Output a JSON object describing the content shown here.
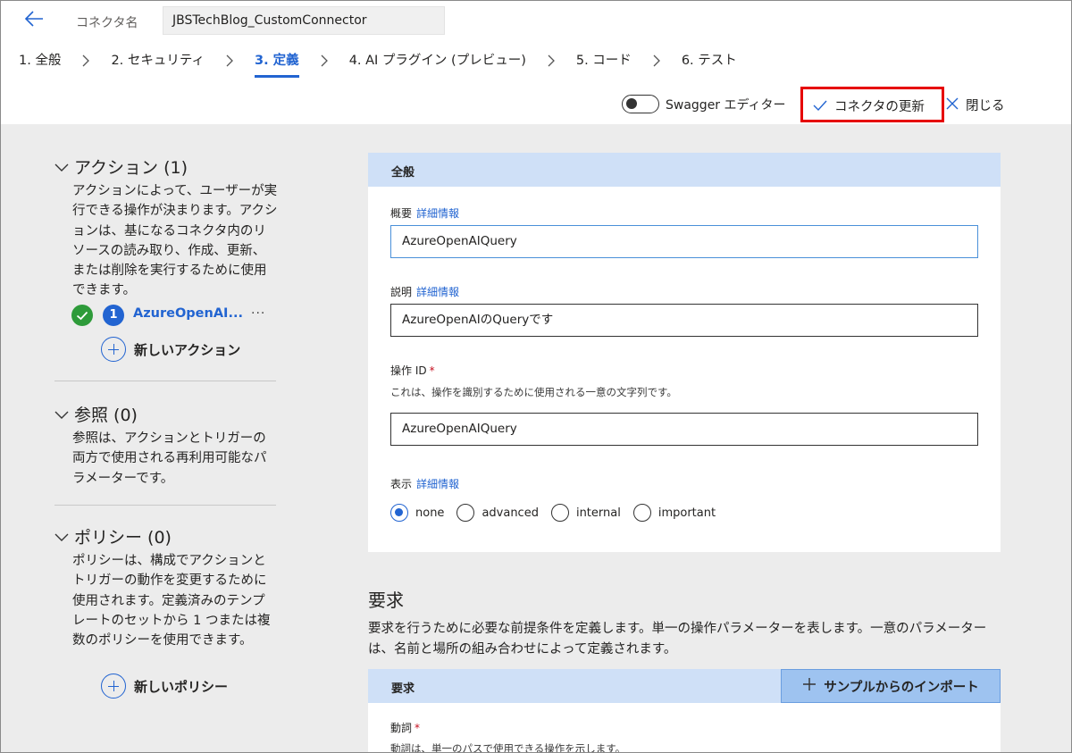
{
  "header": {
    "connector_label": "コネクタ名",
    "connector_name": "JBSTechBlog_CustomConnector"
  },
  "steps": [
    {
      "label": "1. 全般",
      "active": false
    },
    {
      "label": "2. セキュリティ",
      "active": false
    },
    {
      "label": "3. 定義",
      "active": true
    },
    {
      "label": "4. AI プラグイン (プレビュー)",
      "active": false
    },
    {
      "label": "5. コード",
      "active": false
    },
    {
      "label": "6. テスト",
      "active": false
    }
  ],
  "toolbar": {
    "swagger_label": "Swagger エディター",
    "swagger_on": false,
    "update_label": "コネクタの更新",
    "close_label": "閉じる"
  },
  "left": {
    "actions": {
      "title": "アクション (1)",
      "desc": "アクションによって、ユーザーが実行できる操作が決まります。アクションは、基になるコネクタ内のリソースの読み取り、作成、更新、または削除を実行するために使用できます。",
      "item": {
        "number": "1",
        "name": "AzureOpenAI...",
        "more": "···"
      },
      "add_label": "新しいアクション"
    },
    "references": {
      "title": "参照 (0)",
      "desc": "参照は、アクションとトリガーの両方で使用される再利用可能なパラメーターです。"
    },
    "policies": {
      "title": "ポリシー (0)",
      "desc": "ポリシーは、構成でアクションとトリガーの動作を変更するために使用されます。定義済みのテンプレートのセットから 1 つまたは複数のポリシーを使用できます。",
      "add_label": "新しいポリシー"
    }
  },
  "general": {
    "title": "全般",
    "summary": {
      "label": "概要",
      "link": "詳細情報",
      "value": "AzureOpenAIQuery"
    },
    "description": {
      "label": "説明",
      "link": "詳細情報",
      "value": "AzureOpenAIのQueryです"
    },
    "operation_id": {
      "label": "操作 ID",
      "required": "*",
      "help": "これは、操作を識別するために使用される一意の文字列です。",
      "value": "AzureOpenAIQuery"
    },
    "visibility": {
      "label": "表示",
      "link": "詳細情報",
      "options": [
        "none",
        "advanced",
        "internal",
        "important"
      ],
      "selected": "none"
    }
  },
  "request": {
    "title": "要求",
    "desc": "要求を行うために必要な前提条件を定義します。単一の操作パラメーターを表します。一意のパラメーターは、名前と場所の組み合わせによって定義されます。",
    "card_title": "要求",
    "import_label": "サンプルからのインポート",
    "verb_label": "動詞",
    "verb_required": "*",
    "verb_help": "動詞は、単一のパスで使用できる操作を示します。"
  },
  "colors": {
    "accent": "#2264d1",
    "highlight_box": "#e60000",
    "card_header": "#cfe0f7",
    "success": "#2e9b3a"
  }
}
